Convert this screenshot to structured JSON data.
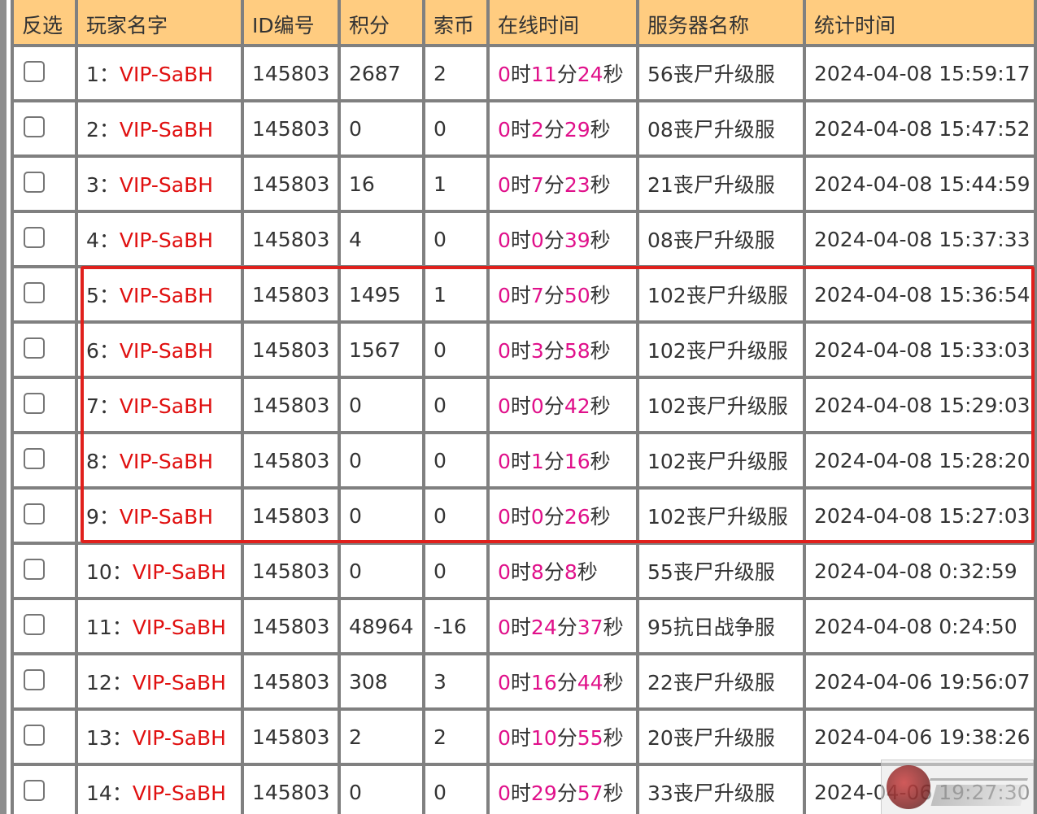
{
  "headers": {
    "select": "反选",
    "player_name": "玩家名字",
    "id": "ID编号",
    "points": "积分",
    "coins": "索币",
    "online_time": "在线时间",
    "server": "服务器名称",
    "stat_time": "统计时间"
  },
  "time_units": {
    "h": "时",
    "m": "分",
    "s": "秒"
  },
  "rows": [
    {
      "idx": "1：",
      "name": "VIP-SaBH",
      "id": "145803",
      "points": "2687",
      "coins": "2",
      "t_h": "0",
      "t_m": "11",
      "t_s": "24",
      "server": "56丧尸升级服",
      "time": "2024-04-08 15:59:17"
    },
    {
      "idx": "2：",
      "name": "VIP-SaBH",
      "id": "145803",
      "points": "0",
      "coins": "0",
      "t_h": "0",
      "t_m": "2",
      "t_s": "29",
      "server": "08丧尸升级服",
      "time": "2024-04-08 15:47:52"
    },
    {
      "idx": "3：",
      "name": "VIP-SaBH",
      "id": "145803",
      "points": "16",
      "coins": "1",
      "t_h": "0",
      "t_m": "7",
      "t_s": "23",
      "server": "21丧尸升级服",
      "time": "2024-04-08 15:44:59"
    },
    {
      "idx": "4：",
      "name": "VIP-SaBH",
      "id": "145803",
      "points": "4",
      "coins": "0",
      "t_h": "0",
      "t_m": "0",
      "t_s": "39",
      "server": "08丧尸升级服",
      "time": "2024-04-08 15:37:33"
    },
    {
      "idx": "5：",
      "name": "VIP-SaBH",
      "id": "145803",
      "points": "1495",
      "coins": "1",
      "t_h": "0",
      "t_m": "7",
      "t_s": "50",
      "server": "102丧尸升级服",
      "time": "2024-04-08 15:36:54"
    },
    {
      "idx": "6：",
      "name": "VIP-SaBH",
      "id": "145803",
      "points": "1567",
      "coins": "0",
      "t_h": "0",
      "t_m": "3",
      "t_s": "58",
      "server": "102丧尸升级服",
      "time": "2024-04-08 15:33:03"
    },
    {
      "idx": "7：",
      "name": "VIP-SaBH",
      "id": "145803",
      "points": "0",
      "coins": "0",
      "t_h": "0",
      "t_m": "0",
      "t_s": "42",
      "server": "102丧尸升级服",
      "time": "2024-04-08 15:29:03"
    },
    {
      "idx": "8：",
      "name": "VIP-SaBH",
      "id": "145803",
      "points": "0",
      "coins": "0",
      "t_h": "0",
      "t_m": "1",
      "t_s": "16",
      "server": "102丧尸升级服",
      "time": "2024-04-08 15:28:20"
    },
    {
      "idx": "9：",
      "name": "VIP-SaBH",
      "id": "145803",
      "points": "0",
      "coins": "0",
      "t_h": "0",
      "t_m": "0",
      "t_s": "26",
      "server": "102丧尸升级服",
      "time": "2024-04-08 15:27:03"
    },
    {
      "idx": "10：",
      "name": "VIP-SaBH",
      "id": "145803",
      "points": "0",
      "coins": "0",
      "t_h": "0",
      "t_m": "8",
      "t_s": "8",
      "server": "55丧尸升级服",
      "time": "2024-04-08 0:32:59"
    },
    {
      "idx": "11：",
      "name": "VIP-SaBH",
      "id": "145803",
      "points": "48964",
      "coins": "-16",
      "t_h": "0",
      "t_m": "24",
      "t_s": "37",
      "server": "95抗日战争服",
      "time": "2024-04-08 0:24:50"
    },
    {
      "idx": "12：",
      "name": "VIP-SaBH",
      "id": "145803",
      "points": "308",
      "coins": "3",
      "t_h": "0",
      "t_m": "16",
      "t_s": "44",
      "server": "22丧尸升级服",
      "time": "2024-04-06 19:56:07"
    },
    {
      "idx": "13：",
      "name": "VIP-SaBH",
      "id": "145803",
      "points": "2",
      "coins": "2",
      "t_h": "0",
      "t_m": "10",
      "t_s": "55",
      "server": "20丧尸升级服",
      "time": "2024-04-06 19:38:26"
    },
    {
      "idx": "14：",
      "name": "VIP-SaBH",
      "id": "145803",
      "points": "0",
      "coins": "0",
      "t_h": "0",
      "t_m": "29",
      "t_s": "57",
      "server": "33丧尸升级服",
      "time": "2024-04-06 19:27:30"
    }
  ],
  "colors": {
    "header_bg": "#ffcc80",
    "grid": "#808080",
    "name_red": "#e01010",
    "id_blue": "#2424d6",
    "points_green": "#228b22",
    "time_pink": "#e0108a",
    "highlight_border": "#e0201c"
  }
}
